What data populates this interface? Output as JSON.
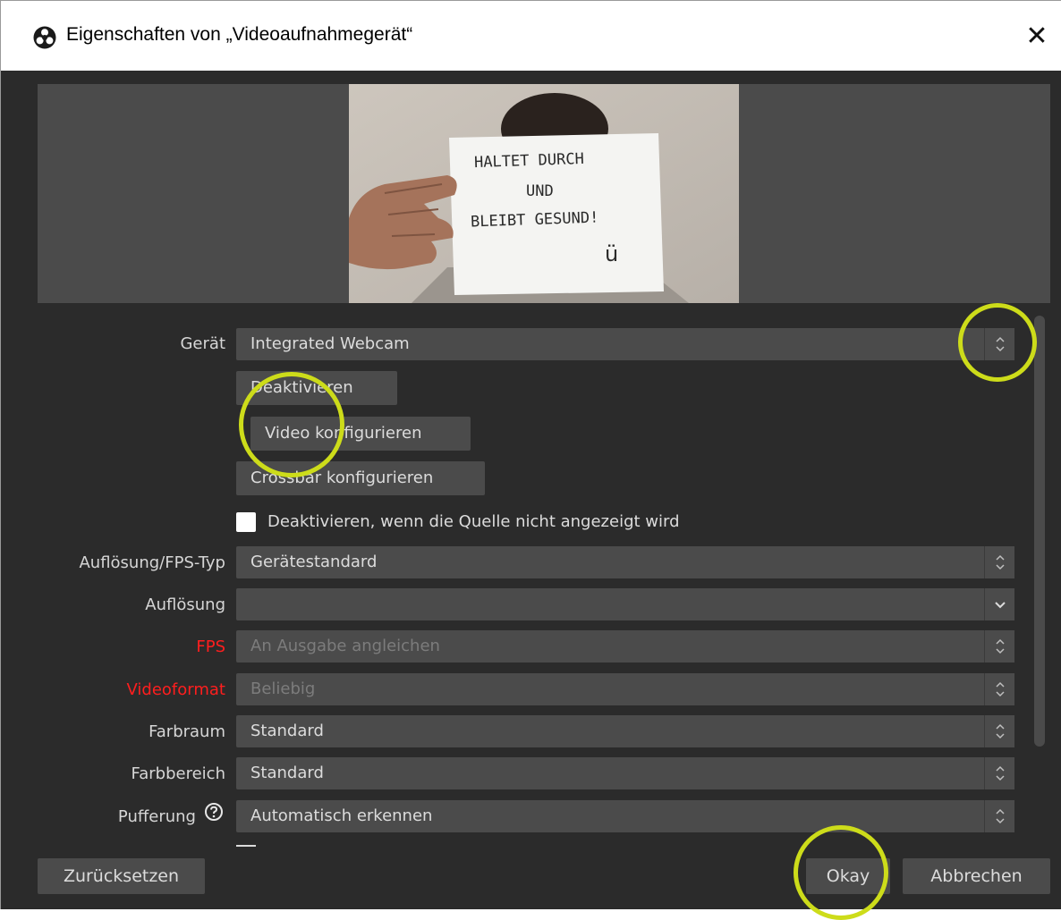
{
  "window": {
    "title": "Eigenschaften von „Videoaufnahmegerät“",
    "close_symbol": "✕",
    "icon": "obs-logo-icon"
  },
  "preview": {
    "sign_lines": [
      "HALTET DURCH",
      "UND",
      "BLEIBT GESUND!"
    ],
    "sign_smiley": "ü"
  },
  "form": {
    "device": {
      "label": "Gerät",
      "value": "Integrated Webcam"
    },
    "buttons": {
      "deactivate": "Deaktivieren",
      "configure_video": "Video konfigurieren",
      "configure_crossbar": "Crossbar konfigurieren"
    },
    "checkbox": {
      "label": "Deaktivieren, wenn die Quelle nicht angezeigt wird",
      "checked": false
    },
    "resolution_fps_type": {
      "label": "Auflösung/FPS-Typ",
      "value": "Gerätestandard"
    },
    "resolution": {
      "label": "Auflösung",
      "value": ""
    },
    "fps": {
      "label": "FPS",
      "value": "An Ausgabe angleichen"
    },
    "video_format": {
      "label": "Videoformat",
      "value": "Beliebig"
    },
    "color_space": {
      "label": "Farbraum",
      "value": "Standard"
    },
    "color_range": {
      "label": "Farbbereich",
      "value": "Standard"
    },
    "buffering": {
      "label": "Pufferung",
      "value": "Automatisch erkennen"
    }
  },
  "footer": {
    "reset": "Zurücksetzen",
    "ok": "Okay",
    "cancel": "Abbrechen"
  },
  "colors": {
    "background": "#2b2b2b",
    "control": "#4b4b4b",
    "text": "#dcdcdc",
    "error_label": "#ff1e1e",
    "highlight": "#cddc1a"
  }
}
